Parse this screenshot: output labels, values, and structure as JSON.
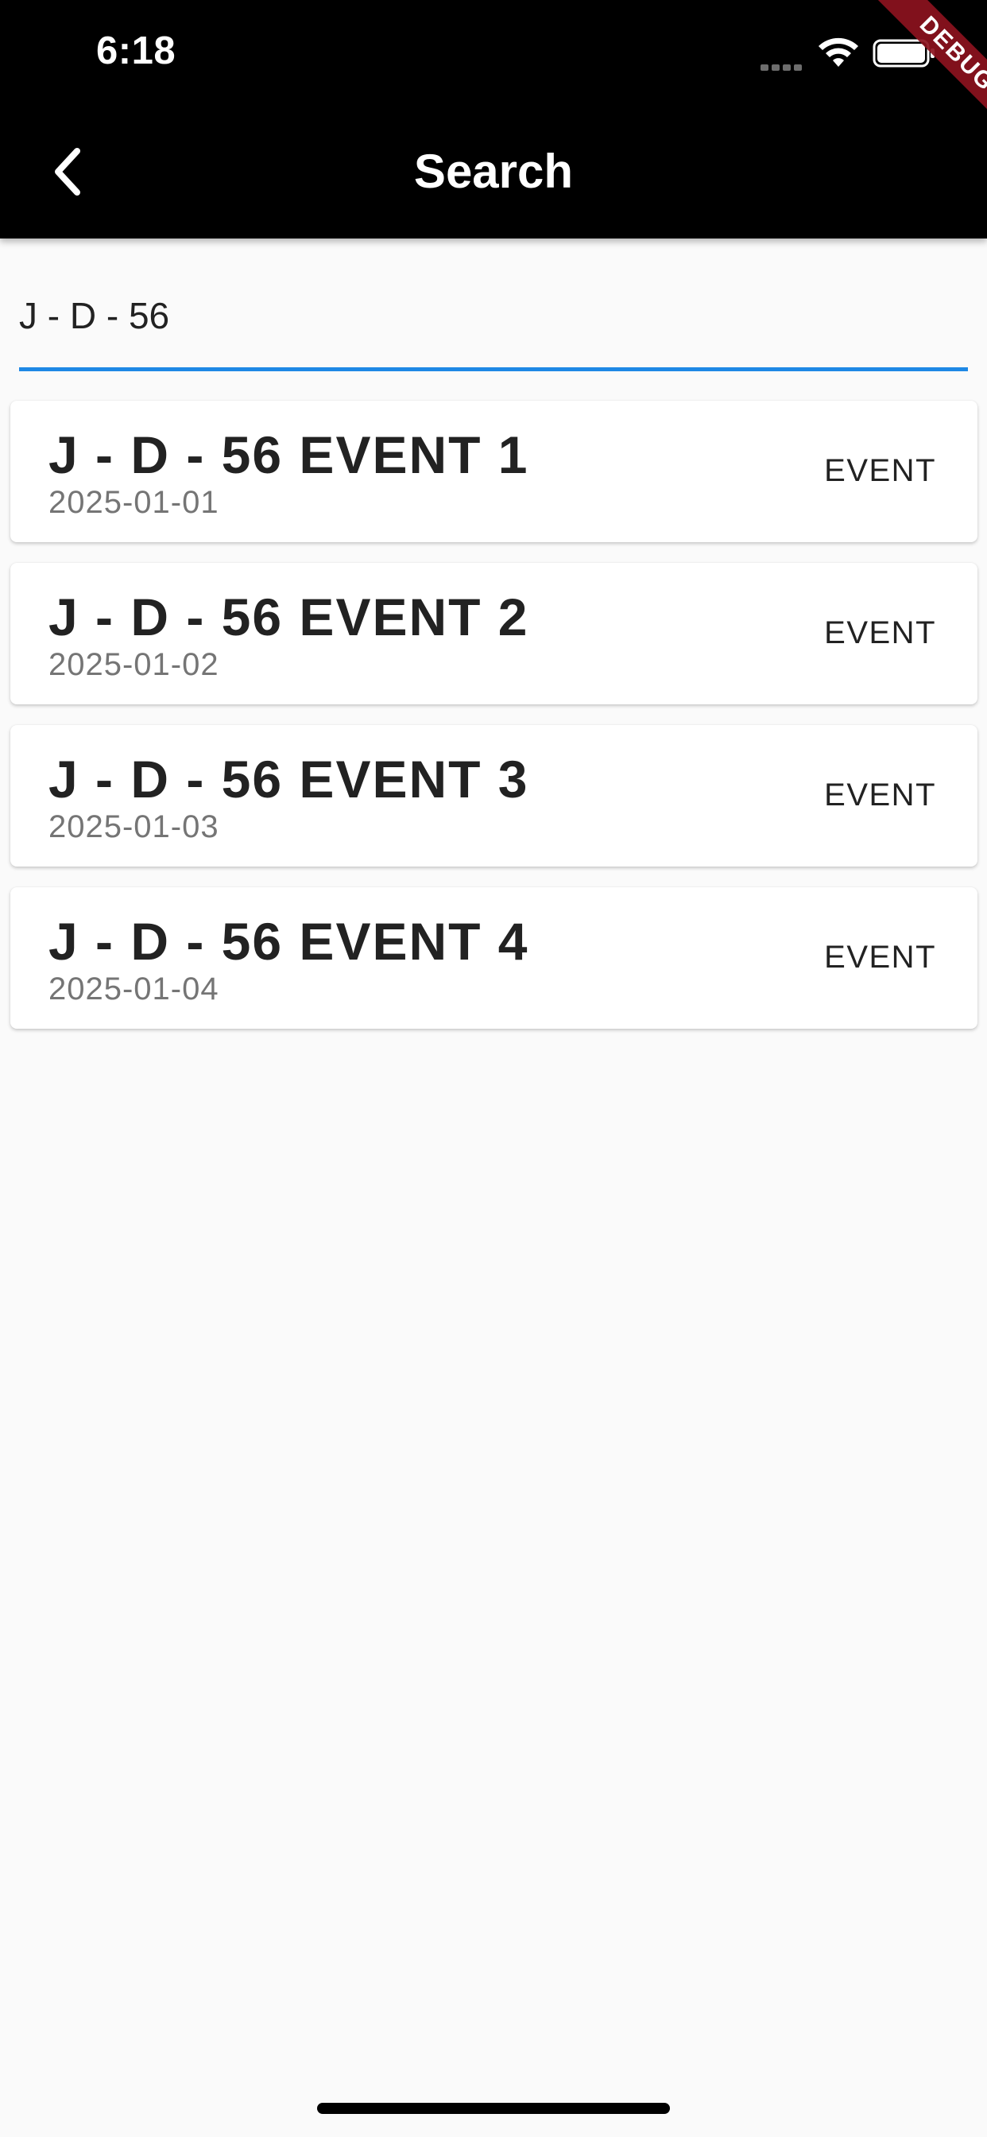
{
  "status_bar": {
    "time": "6:18",
    "icons": [
      "cellular-signal-icon",
      "wifi-icon",
      "battery-icon"
    ]
  },
  "app_bar": {
    "back_icon": "chevron-left-icon",
    "title": "Search",
    "debug_label": "DEBUG"
  },
  "search": {
    "value": "J - D - 56",
    "underline_color": "#1e88e5"
  },
  "results": [
    {
      "title": "J - D - 56 EVENT 1",
      "date": "2025-01-01",
      "type": "EVENT"
    },
    {
      "title": "J - D - 56 EVENT 2",
      "date": "2025-01-02",
      "type": "EVENT"
    },
    {
      "title": "J - D - 56 EVENT 3",
      "date": "2025-01-03",
      "type": "EVENT"
    },
    {
      "title": "J - D - 56 EVENT 4",
      "date": "2025-01-04",
      "type": "EVENT"
    }
  ],
  "colors": {
    "app_bar_background": "#000000",
    "page_background": "#fafafa",
    "card_background": "#ffffff",
    "title_text": "#222222",
    "secondary_text": "#757575",
    "debug_banner": "#8c121e"
  }
}
